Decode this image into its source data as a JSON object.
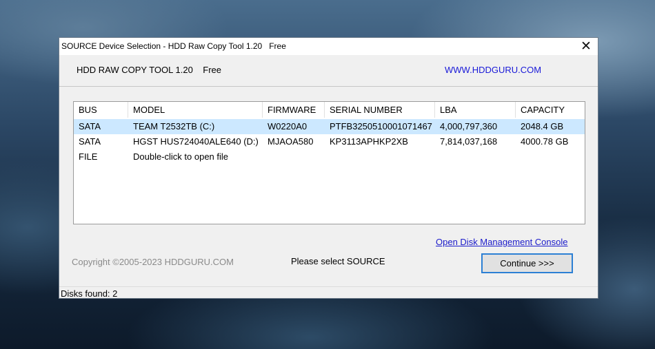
{
  "window": {
    "title": "SOURCE Device Selection - HDD Raw Copy Tool 1.20   Free",
    "close_glyph": "✕"
  },
  "header": {
    "app_name": "HDD RAW COPY TOOL 1.20    Free",
    "website": "WWW.HDDGURU.COM"
  },
  "table": {
    "columns": [
      "BUS",
      "MODEL",
      "FIRMWARE",
      "SERIAL NUMBER",
      "LBA",
      "CAPACITY"
    ],
    "rows": [
      {
        "bus": "SATA",
        "model": "TEAM T2532TB (C:)",
        "firmware": "W0220A0",
        "serial": "PTFB3250510001071467",
        "lba": "4,000,797,360",
        "capacity": "2048.4 GB",
        "selected": true
      },
      {
        "bus": "SATA",
        "model": "HGST HUS724040ALE640 (D:)",
        "firmware": "MJAOA580",
        "serial": "KP3113APHKP2XB",
        "lba": "7,814,037,168",
        "capacity": "4000.78 GB",
        "selected": false
      },
      {
        "bus": "FILE",
        "model": "Double-click to open file",
        "firmware": "",
        "serial": "",
        "lba": "",
        "capacity": "",
        "selected": false
      }
    ]
  },
  "footer": {
    "disk_mgmt_link": "Open Disk Management Console",
    "copyright": "Copyright ©2005-2023 HDDGURU.COM",
    "status_message": "Please select SOURCE",
    "continue_label": "Continue >>>"
  },
  "statusbar": {
    "text": "Disks found: 2"
  },
  "colors": {
    "link": "#1919d8",
    "selection": "#cce8ff",
    "button_focus": "#2b7fd4"
  }
}
